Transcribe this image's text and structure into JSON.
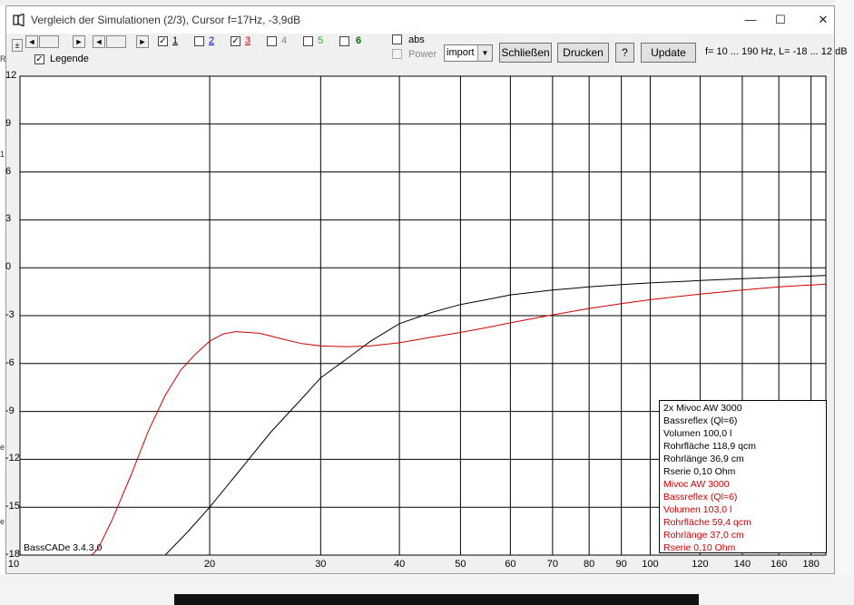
{
  "window": {
    "title": "Vergleich der Simulationen (2/3), Cursor f=17Hz, -3,9dB",
    "controls": {
      "minimize": "—",
      "maximize": "☐",
      "close": "✕"
    }
  },
  "background": {
    "left_marks": [
      "R",
      "1",
      "e",
      "e"
    ]
  },
  "toolbar": {
    "nav_buttons": [
      "±",
      "◄",
      "►",
      "◄",
      "►"
    ],
    "channels": [
      {
        "label": "1",
        "checked": true,
        "color": "#000000"
      },
      {
        "label": "2",
        "checked": false,
        "color": "#0000cc"
      },
      {
        "label": "3",
        "checked": true,
        "color": "#cc0000"
      },
      {
        "label": "4",
        "checked": false,
        "color": "#888888"
      },
      {
        "label": "5",
        "checked": false,
        "color": "#22bb22"
      },
      {
        "label": "6",
        "checked": false,
        "color": "#006600"
      }
    ],
    "legende_label": "Legende",
    "legende_checked": true,
    "abs_label": "abs",
    "power_label": "Power",
    "select_value": "import",
    "close_button": "Schließen",
    "print_button": "Drucken",
    "help_button": "?",
    "update_button": "Update",
    "range_text": "f= 10 ... 190 Hz, L= -18 ... 12 dB"
  },
  "chart_data": {
    "type": "line",
    "xscale": "log",
    "xlim": [
      10,
      190
    ],
    "ylim": [
      -18,
      12
    ],
    "y_ticks": [
      12,
      9,
      6,
      3,
      0,
      -3,
      -6,
      -9,
      -12,
      -15,
      -18
    ],
    "y_tick_labels": [
      "12",
      "9",
      "6",
      "3",
      "0",
      "-3",
      "-6",
      "-9",
      "-12",
      "-15",
      "-18"
    ],
    "x_ticks": [
      10,
      20,
      30,
      40,
      50,
      60,
      70,
      80,
      90,
      100,
      120,
      140,
      160,
      180
    ],
    "x_tick_labels": [
      "10",
      "20",
      "30",
      "40",
      "50",
      "60",
      "70",
      "80",
      "90",
      "100",
      "120",
      "140",
      "160",
      "180"
    ],
    "grid": true,
    "series": [
      {
        "color": "#000000",
        "points": [
          [
            17.0,
            -18.0
          ],
          [
            18.5,
            -16.5
          ],
          [
            20,
            -15.0
          ],
          [
            22,
            -13.0
          ],
          [
            25,
            -10.3
          ],
          [
            28,
            -8.2
          ],
          [
            30,
            -6.9
          ],
          [
            33,
            -5.7
          ],
          [
            36,
            -4.6
          ],
          [
            40,
            -3.5
          ],
          [
            45,
            -2.8
          ],
          [
            50,
            -2.3
          ],
          [
            55,
            -2.0
          ],
          [
            60,
            -1.7
          ],
          [
            70,
            -1.4
          ],
          [
            80,
            -1.2
          ],
          [
            90,
            -1.05
          ],
          [
            100,
            -0.95
          ],
          [
            120,
            -0.8
          ],
          [
            140,
            -0.68
          ],
          [
            160,
            -0.6
          ],
          [
            180,
            -0.52
          ],
          [
            190,
            -0.48
          ]
        ]
      },
      {
        "color": "#cc0000",
        "points": [
          [
            10,
            -18.0
          ],
          [
            13.0,
            -18.0
          ],
          [
            13.3,
            -17.6
          ],
          [
            14.0,
            -15.8
          ],
          [
            15.0,
            -13.0
          ],
          [
            16.0,
            -10.2
          ],
          [
            17.0,
            -8.0
          ],
          [
            18.0,
            -6.4
          ],
          [
            19.0,
            -5.4
          ],
          [
            20.0,
            -4.6
          ],
          [
            21.0,
            -4.15
          ],
          [
            22.0,
            -4.0
          ],
          [
            24.0,
            -4.1
          ],
          [
            26.0,
            -4.45
          ],
          [
            28.0,
            -4.75
          ],
          [
            30.0,
            -4.9
          ],
          [
            33.0,
            -4.95
          ],
          [
            36.0,
            -4.9
          ],
          [
            40.0,
            -4.7
          ],
          [
            45.0,
            -4.35
          ],
          [
            50.0,
            -4.05
          ],
          [
            55.0,
            -3.75
          ],
          [
            60.0,
            -3.45
          ],
          [
            70.0,
            -2.95
          ],
          [
            80.0,
            -2.55
          ],
          [
            90.0,
            -2.25
          ],
          [
            100.0,
            -2.0
          ],
          [
            120.0,
            -1.65
          ],
          [
            140.0,
            -1.4
          ],
          [
            160.0,
            -1.2
          ],
          [
            180.0,
            -1.08
          ],
          [
            190.0,
            -1.02
          ]
        ]
      }
    ],
    "legend_placement": "bottom-right",
    "legend": [
      {
        "color": "#000000",
        "lines": [
          "2x Mivoc AW 3000",
          "Bassreflex (Ql=6)",
          "Volumen 100,0 l",
          "Rohrfläche 118,9 qcm",
          "Rohrlänge 36,9 cm",
          "Rserie 0,10 Ohm"
        ]
      },
      {
        "color": "#cc0000",
        "lines": [
          "Mivoc AW 3000",
          "Bassreflex (Ql=6)",
          "Volumen 103,0 l",
          "Rohrfläche 59,4 qcm",
          "Rohrlänge 37,0 cm",
          "Rserie 0,10 Ohm"
        ]
      }
    ],
    "watermark": "BassCADe 3.4.3.0"
  }
}
